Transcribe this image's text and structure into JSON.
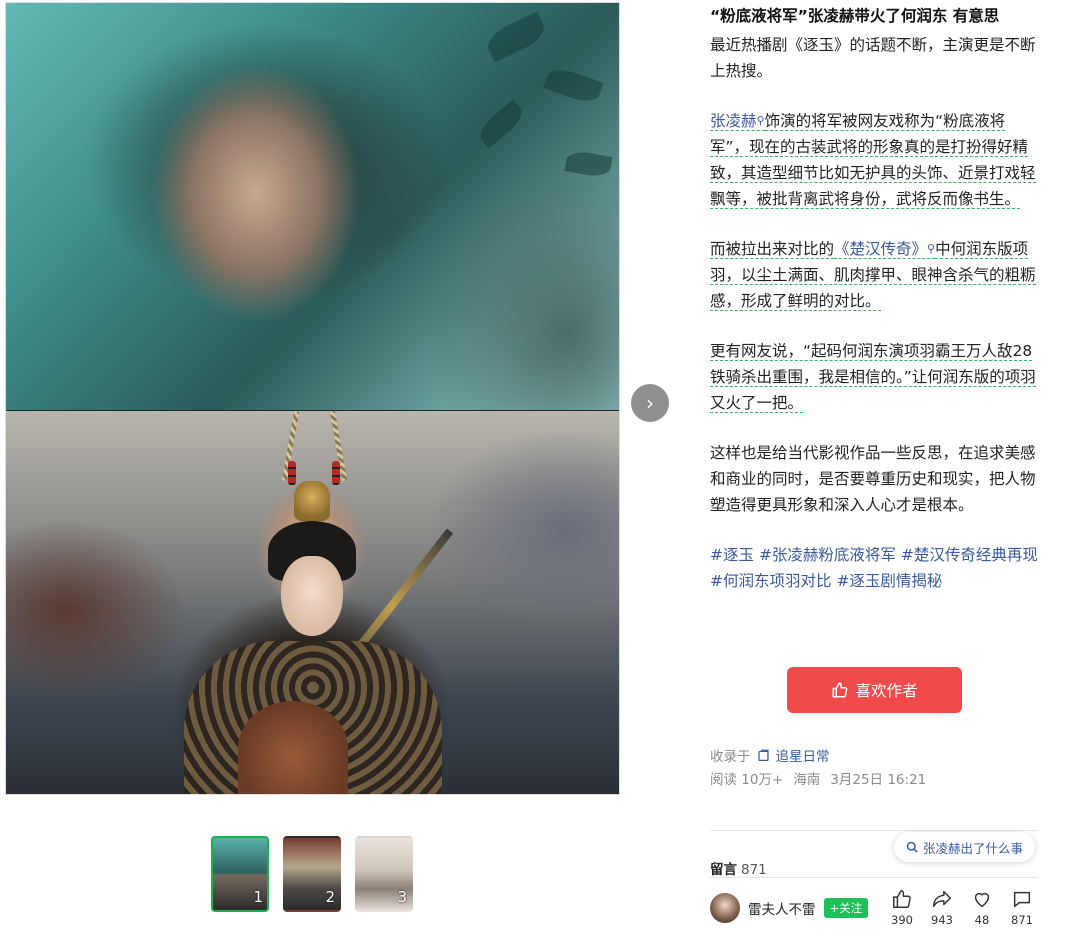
{
  "gallery": {
    "next_glyph": "›",
    "thumbnails": [
      {
        "num": "1"
      },
      {
        "num": "2"
      },
      {
        "num": "3"
      }
    ]
  },
  "article": {
    "title": "“粉底液将军”张凌赫带火了何润东 有意思",
    "p1": "最近热播剧《逐玉》的话题不断，主演更是不断上热搜。",
    "p2_link": "张凌赫",
    "p2_rest": "饰演的将军被网友戏称为“粉底液将军”，现在的古装武将的形象真的是打扮得好精致，其造型细节比如无护具的头饰、近景打戏轻飘等，被批背离武将身份，武将反而像书生。",
    "p3_pre": "而被拉出来对比的",
    "p3_link": "《楚汉传奇》",
    "p3_rest": "中何润东版项羽，以尘土满面、肌肉撑甲、眼神含杀气的粗粝感，形成了鲜明的对比。",
    "p4": "更有网友说，“起码何润东演项羽霸王万人敌28铁骑杀出重围，我是相信的。”让何润东版的项羽又火了一把。",
    "p5": "这样也是给当代影视作品一些反思，在追求美感和商业的同时，是否要尊重历史和现实，把人物塑造得更具形象和深入人心才是根本。",
    "tags": [
      "#逐玉",
      "#张凌赫粉底液将军",
      "#楚汉传奇经典再现",
      "#何润东项羽对比",
      "#逐玉剧情揭秘"
    ]
  },
  "like_button": {
    "label": "喜欢作者"
  },
  "meta": {
    "collected_prefix": "收录于",
    "collection": "追星日常",
    "reads": "阅读 10万+",
    "location": "海南",
    "datetime": "3月25日 16:21"
  },
  "search_pill": {
    "label": "张凌赫出了什么事"
  },
  "comments": {
    "label": "留言",
    "count": "871"
  },
  "author": {
    "name": "雷夫人不雷",
    "follow_label": "+关注"
  },
  "actions": {
    "like": "390",
    "share": "943",
    "heart": "48",
    "comment": "871"
  },
  "colors": {
    "accent_red": "#f24a4a",
    "follow_green": "#1fbf5a",
    "link_blue": "#3a5a9c",
    "active_thumb_border": "#18b34a"
  }
}
